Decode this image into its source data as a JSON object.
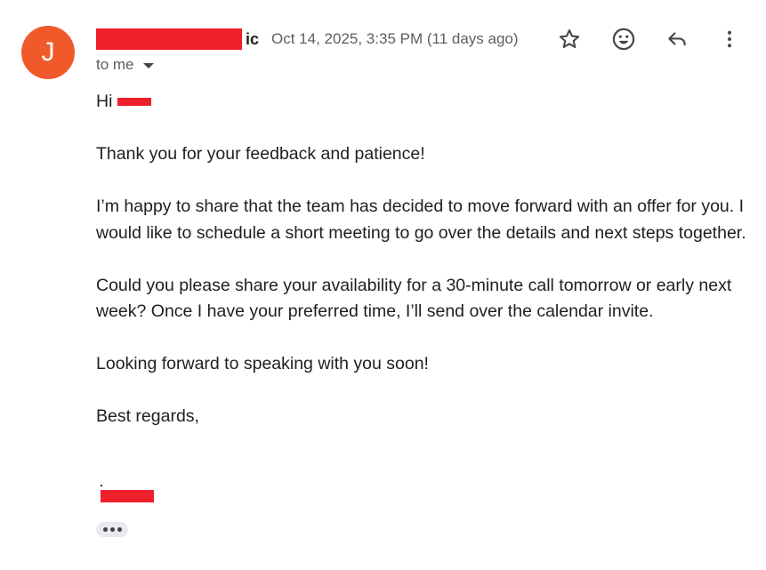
{
  "sender": {
    "avatar_initial": "J",
    "avatar_color": "#f05a2a",
    "name_visible_suffix": "ic",
    "date": "Oct 14, 2025, 3:35 PM (11 days ago)"
  },
  "recipient": {
    "label": "to me"
  },
  "actions": [
    {
      "name": "star",
      "icon": "star-icon"
    },
    {
      "name": "react",
      "icon": "emoji-icon"
    },
    {
      "name": "reply",
      "icon": "reply-icon"
    },
    {
      "name": "more",
      "icon": "more-vert-icon"
    }
  ],
  "body": {
    "greeting": "Hi",
    "p1": "Thank you for your feedback and patience!",
    "p2": "I’m happy to share that the team has decided to move forward with an offer for you. I would like to schedule a short meeting to go over the details and next steps together.",
    "p3": "Could you please share your availability for a 30-minute call tomorrow or early next week? Once I have your preferred time, I’ll send over the calendar invite.",
    "p4": "Looking forward to speaking with you soon!",
    "closing": "Best regards,"
  },
  "colors": {
    "redaction": "#ef1f2b",
    "text": "#1f1f1f",
    "secondary_text": "#5e5e5e"
  }
}
